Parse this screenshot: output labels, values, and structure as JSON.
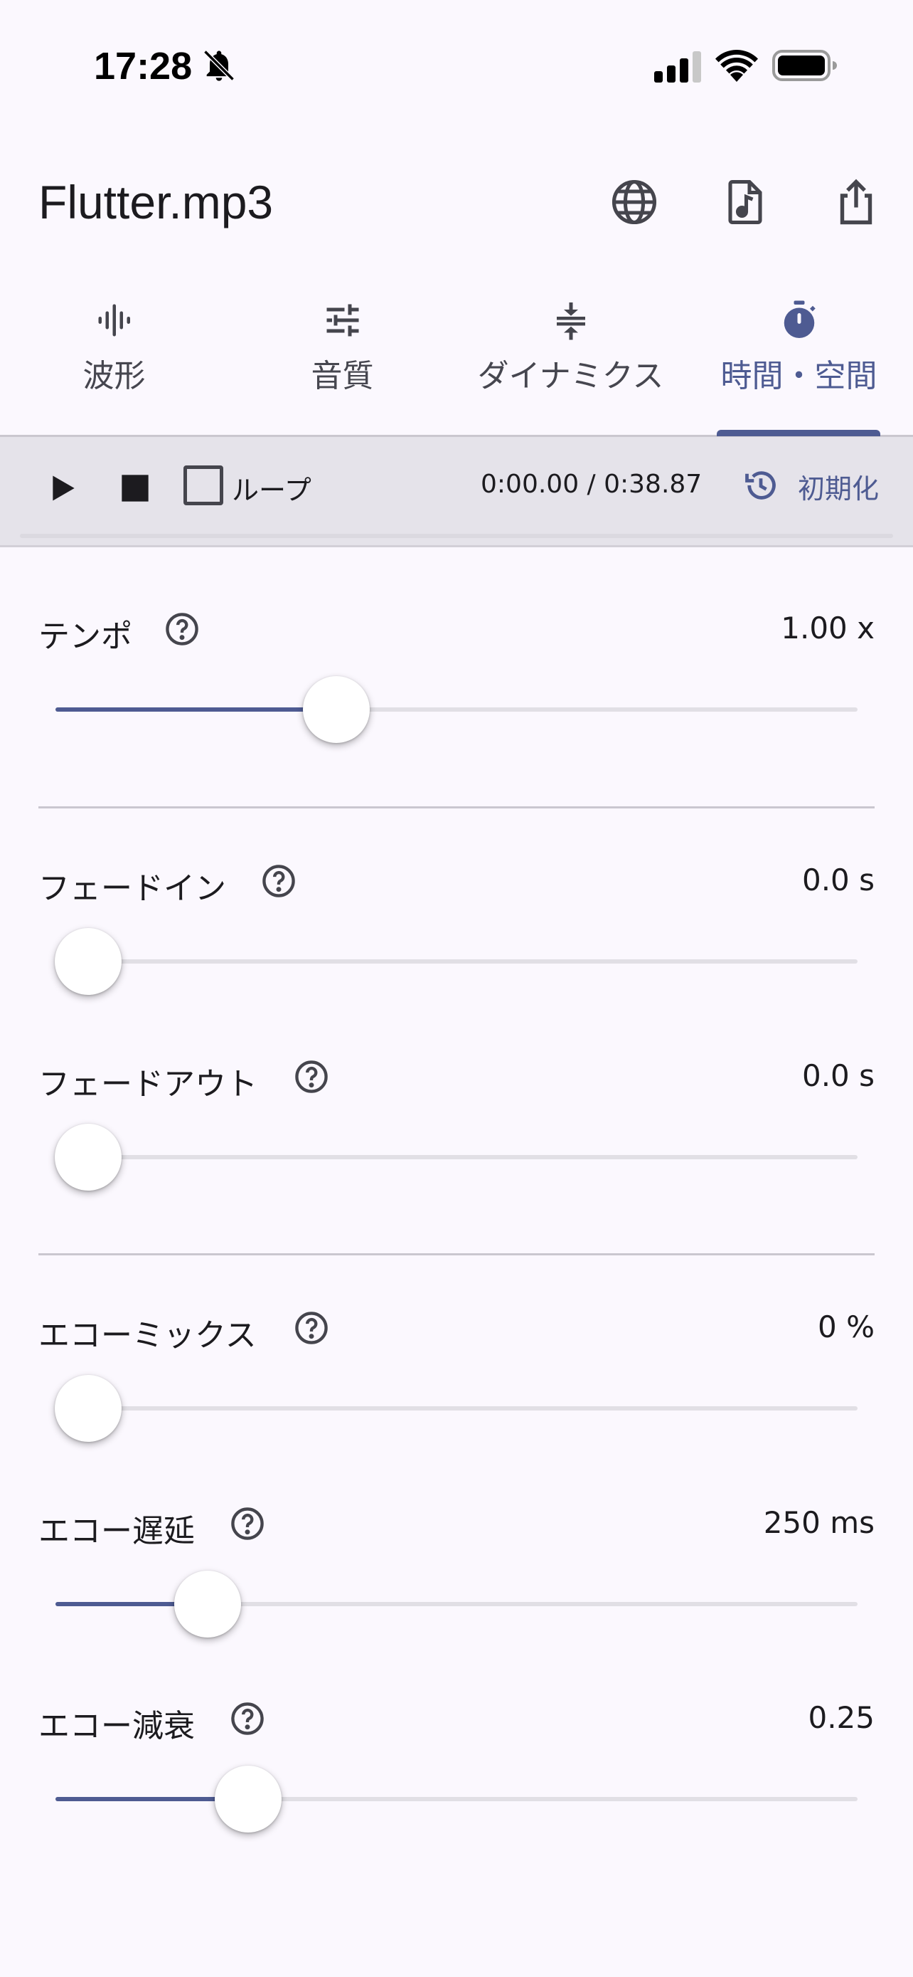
{
  "status_bar": {
    "time": "17:28"
  },
  "app_bar": {
    "title": "Flutter.mp3",
    "actions": [
      "globe-icon",
      "audio-file-icon",
      "share-icon"
    ]
  },
  "tabs": [
    {
      "label": "波形",
      "icon": "waveform-icon",
      "active": false
    },
    {
      "label": "音質",
      "icon": "equalizer-icon",
      "active": false
    },
    {
      "label": "ダイナミクス",
      "icon": "compress-icon",
      "active": false
    },
    {
      "label": "時間・空間",
      "icon": "timer-icon",
      "active": true
    }
  ],
  "player": {
    "loop_label": "ループ",
    "loop_checked": false,
    "time": "0:00.00 / 0:38.87",
    "reset_label": "初期化"
  },
  "controls": {
    "tempo": {
      "label": "テンポ",
      "value": "1.00 x",
      "position": 0.35
    },
    "fade_in": {
      "label": "フェードイン",
      "value": "0.0 s",
      "position": 0.0
    },
    "fade_out": {
      "label": "フェードアウト",
      "value": "0.0 s",
      "position": 0.0
    },
    "echo_mix": {
      "label": "エコーミックス",
      "value": "0 %",
      "position": 0.0
    },
    "echo_delay": {
      "label": "エコー遅延",
      "value": "250 ms",
      "position": 0.19
    },
    "echo_decay": {
      "label": "エコー減衰",
      "value": "0.25",
      "position": 0.24
    }
  },
  "colors": {
    "accent": "#4e5b92",
    "background": "#fbf8fe",
    "player_bar": "#e5e3ea"
  }
}
